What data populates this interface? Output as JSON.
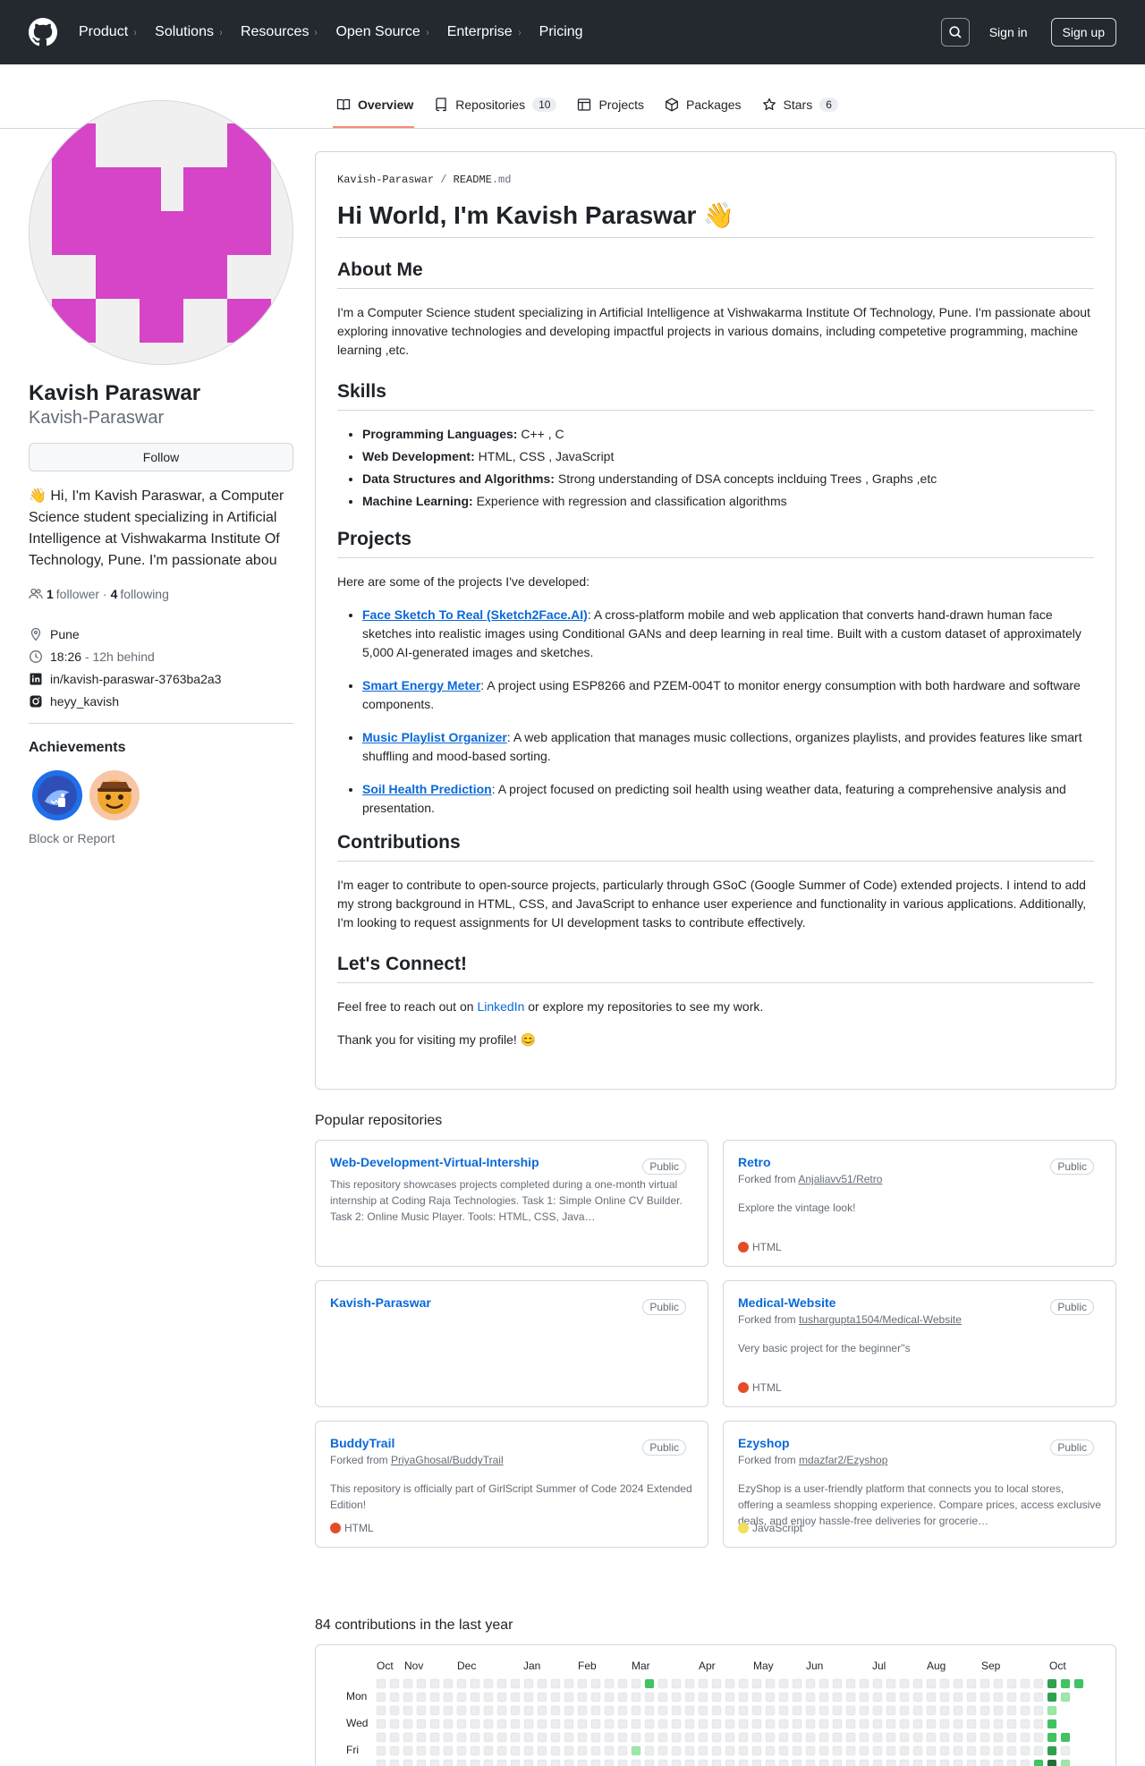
{
  "header": {
    "nav": [
      "Product",
      "Solutions",
      "Resources",
      "Open Source",
      "Enterprise",
      "Pricing"
    ],
    "nav_has_chevron": [
      true,
      true,
      true,
      true,
      true,
      false
    ],
    "sign_in": "Sign in",
    "sign_up": "Sign up"
  },
  "tabs": [
    {
      "label": "Overview",
      "icon": "book-icon",
      "count": null,
      "active": true
    },
    {
      "label": "Repositories",
      "icon": "repo-icon",
      "count": "10",
      "active": false
    },
    {
      "label": "Projects",
      "icon": "table-icon",
      "count": null,
      "active": false
    },
    {
      "label": "Packages",
      "icon": "package-icon",
      "count": null,
      "active": false
    },
    {
      "label": "Stars",
      "icon": "star-icon",
      "count": "6",
      "active": false
    }
  ],
  "profile": {
    "name": "Kavish Paraswar",
    "username": "Kavish-Paraswar",
    "follow": "Follow",
    "bio": "👋 Hi, I'm Kavish Paraswar, a Computer Science student specializing in Artificial Intelligence at Vishwakarma Institute Of Technology, Pune. I'm passionate abou",
    "followers": "1",
    "followers_label": "follower",
    "following": "4",
    "following_label": "following",
    "location": "Pune",
    "time": "18:26",
    "time_note": "- 12h behind",
    "linkedin": "in/kavish-paraswar-3763ba2a3",
    "instagram": "heyy_kavish",
    "achievements_title": "Achievements",
    "block": "Block or Report"
  },
  "readme": {
    "crumb_user": "Kavish-Paraswar",
    "crumb_sep": "/",
    "crumb_file": "README",
    "crumb_ext": ".md",
    "title": "Hi World, I'm Kavish Paraswar 👋",
    "about_h": "About Me",
    "about": "I'm a Computer Science student specializing in Artificial Intelligence at Vishwakarma Institute Of Technology, Pune. I'm passionate about exploring innovative technologies and developing impactful projects in various domains, including competetive programming, machine learning ,etc.",
    "skills_h": "Skills",
    "skills": [
      {
        "k": "Programming Languages:",
        "v": " C++ , C"
      },
      {
        "k": "Web Development:",
        "v": " HTML, CSS , JavaScript"
      },
      {
        "k": "Data Structures and Algorithms:",
        "v": " Strong understanding of DSA concepts inclduing Trees , Graphs ,etc"
      },
      {
        "k": "Machine Learning:",
        "v": " Experience with regression and classification algorithms"
      }
    ],
    "projects_h": "Projects",
    "projects_intro": "Here are some of the projects I've developed:",
    "projects": [
      {
        "name": "Face Sketch To Real (Sketch2Face.AI)",
        "desc": ": A cross-platform mobile and web application that converts hand-drawn human face sketches into realistic images using Conditional GANs and deep learning in real time. Built with a custom dataset of approximately 5,000 AI-generated images and sketches."
      },
      {
        "name": "Smart Energy Meter",
        "desc": ": A project using ESP8266 and PZEM-004T to monitor energy consumption with both hardware and software components."
      },
      {
        "name": "Music Playlist Organizer",
        "desc": ": A web application that manages music collections, organizes playlists, and provides features like smart shuffling and mood-based sorting."
      },
      {
        "name": "Soil Health Prediction",
        "desc": ": A project focused on predicting soil health using weather data, featuring a comprehensive analysis and presentation."
      }
    ],
    "contrib_h": "Contributions",
    "contrib": "I'm eager to contribute to open-source projects, particularly through GSoC (Google Summer of Code) extended projects. I intend to add my strong background in HTML, CSS, and JavaScript to enhance user experience and functionality in various applications. Additionally, I'm looking to request assignments for UI development tasks to contribute effectively.",
    "connect_h": "Let's Connect!",
    "connect_pre": "Feel free to reach out on ",
    "connect_link": "LinkedIn",
    "connect_post": " or explore my repositories to see my work.",
    "thanks": "Thank you for visiting my profile! 😊"
  },
  "popular": {
    "title": "Popular repositories",
    "public_label": "Public",
    "forked_prefix": "Forked from ",
    "repos": [
      {
        "name": "Web-Development-Virtual-Intership",
        "forked": "",
        "desc": "This repository showcases projects completed during a one-month virtual internship at Coding Raja Technologies. Task 1: Simple Online CV Builder. Task 2: Online Music Player. Tools: HTML, CSS, Java…",
        "lang": "",
        "lang_color": ""
      },
      {
        "name": "Retro",
        "forked": "Anjaliavv51/Retro",
        "desc": "Explore the vintage look!",
        "lang": "HTML",
        "lang_color": "#e34c26"
      },
      {
        "name": "Kavish-Paraswar",
        "forked": "",
        "desc": "",
        "lang": "",
        "lang_color": ""
      },
      {
        "name": "Medical-Website",
        "forked": "tushargupta1504/Medical-Website",
        "desc": "Very basic project for the beginner''s",
        "lang": "HTML",
        "lang_color": "#e34c26"
      },
      {
        "name": "BuddyTrail",
        "forked": "PriyaGhosal/BuddyTrail",
        "desc": "This repository is officially part of GirlScript Summer of Code 2024 Extended Edition!",
        "lang": "HTML",
        "lang_color": "#e34c26"
      },
      {
        "name": "Ezyshop",
        "forked": "mdazfar2/Ezyshop",
        "desc": "EzyShop is a user-friendly platform that connects you to local stores, offering a seamless shopping experience. Compare prices, access exclusive deals, and enjoy hassle-free deliveries for grocerie…",
        "lang": "JavaScript",
        "lang_color": "#f1e05a"
      }
    ]
  },
  "contributions": {
    "title": "84 contributions in the last year",
    "months": [
      "Oct",
      "Nov",
      "Dec",
      "Jan",
      "Feb",
      "Mar",
      "Apr",
      "May",
      "Jun",
      "Jul",
      "Aug",
      "Sep",
      "Oct"
    ],
    "days": [
      "Mon",
      "Wed",
      "Fri"
    ],
    "levels": [
      "#ebedf0",
      "#9be9a8",
      "#40c463",
      "#30a14e",
      "#216e39"
    ]
  }
}
